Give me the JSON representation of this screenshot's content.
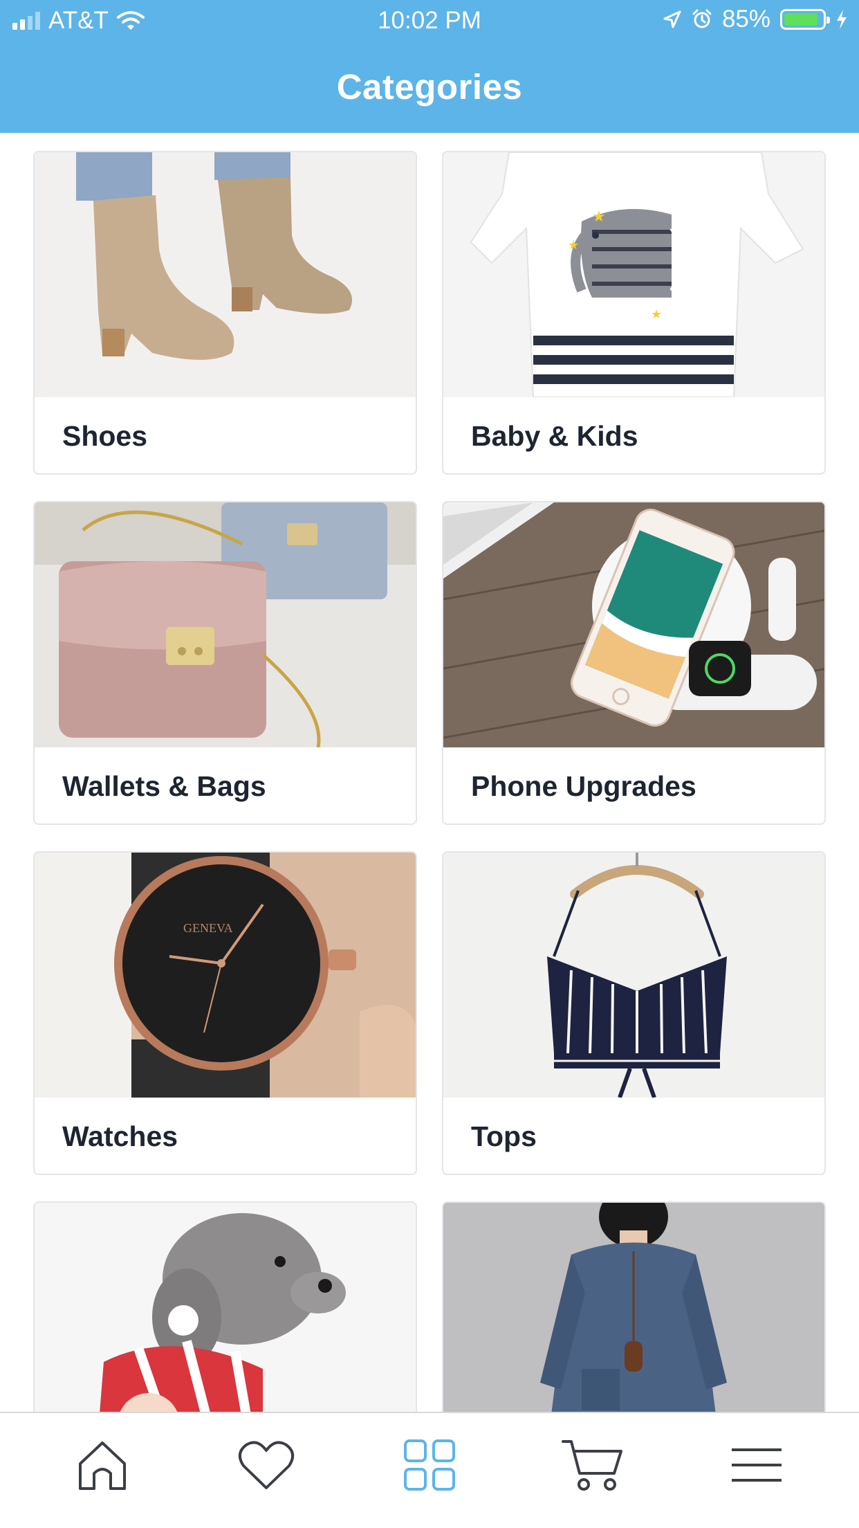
{
  "status_bar": {
    "carrier": "AT&T",
    "time": "10:02 PM",
    "battery": "85%",
    "battery_level": 0.85
  },
  "header": {
    "title": "Categories"
  },
  "categories": [
    {
      "label": "Shoes",
      "image": "tan-ankle-boots"
    },
    {
      "label": "Baby & Kids",
      "image": "elephant-striped-romper"
    },
    {
      "label": "Wallets & Bags",
      "image": "pink-croc-handbag"
    },
    {
      "label": "Phone Upgrades",
      "image": "wireless-charging-pad-phone-watch"
    },
    {
      "label": "Watches",
      "image": "black-rose-gold-watch"
    },
    {
      "label": "Tops",
      "image": "striped-cami-top"
    },
    {
      "label": "",
      "image": "poodle-in-christmas-sweater"
    },
    {
      "label": "",
      "image": "denim-dress"
    }
  ],
  "tabbar": {
    "items": [
      {
        "name": "home",
        "icon": "home-icon",
        "active": false
      },
      {
        "name": "wishlist",
        "icon": "heart-icon",
        "active": false
      },
      {
        "name": "categories",
        "icon": "grid-icon",
        "active": true
      },
      {
        "name": "cart",
        "icon": "cart-icon",
        "active": false
      },
      {
        "name": "menu",
        "icon": "menu-icon",
        "active": false
      }
    ]
  },
  "colors": {
    "header_bg": "#5db4e8",
    "active_tab": "#5db4e8",
    "inactive_tab": "#3b3f45",
    "label_text": "#1d2530"
  }
}
